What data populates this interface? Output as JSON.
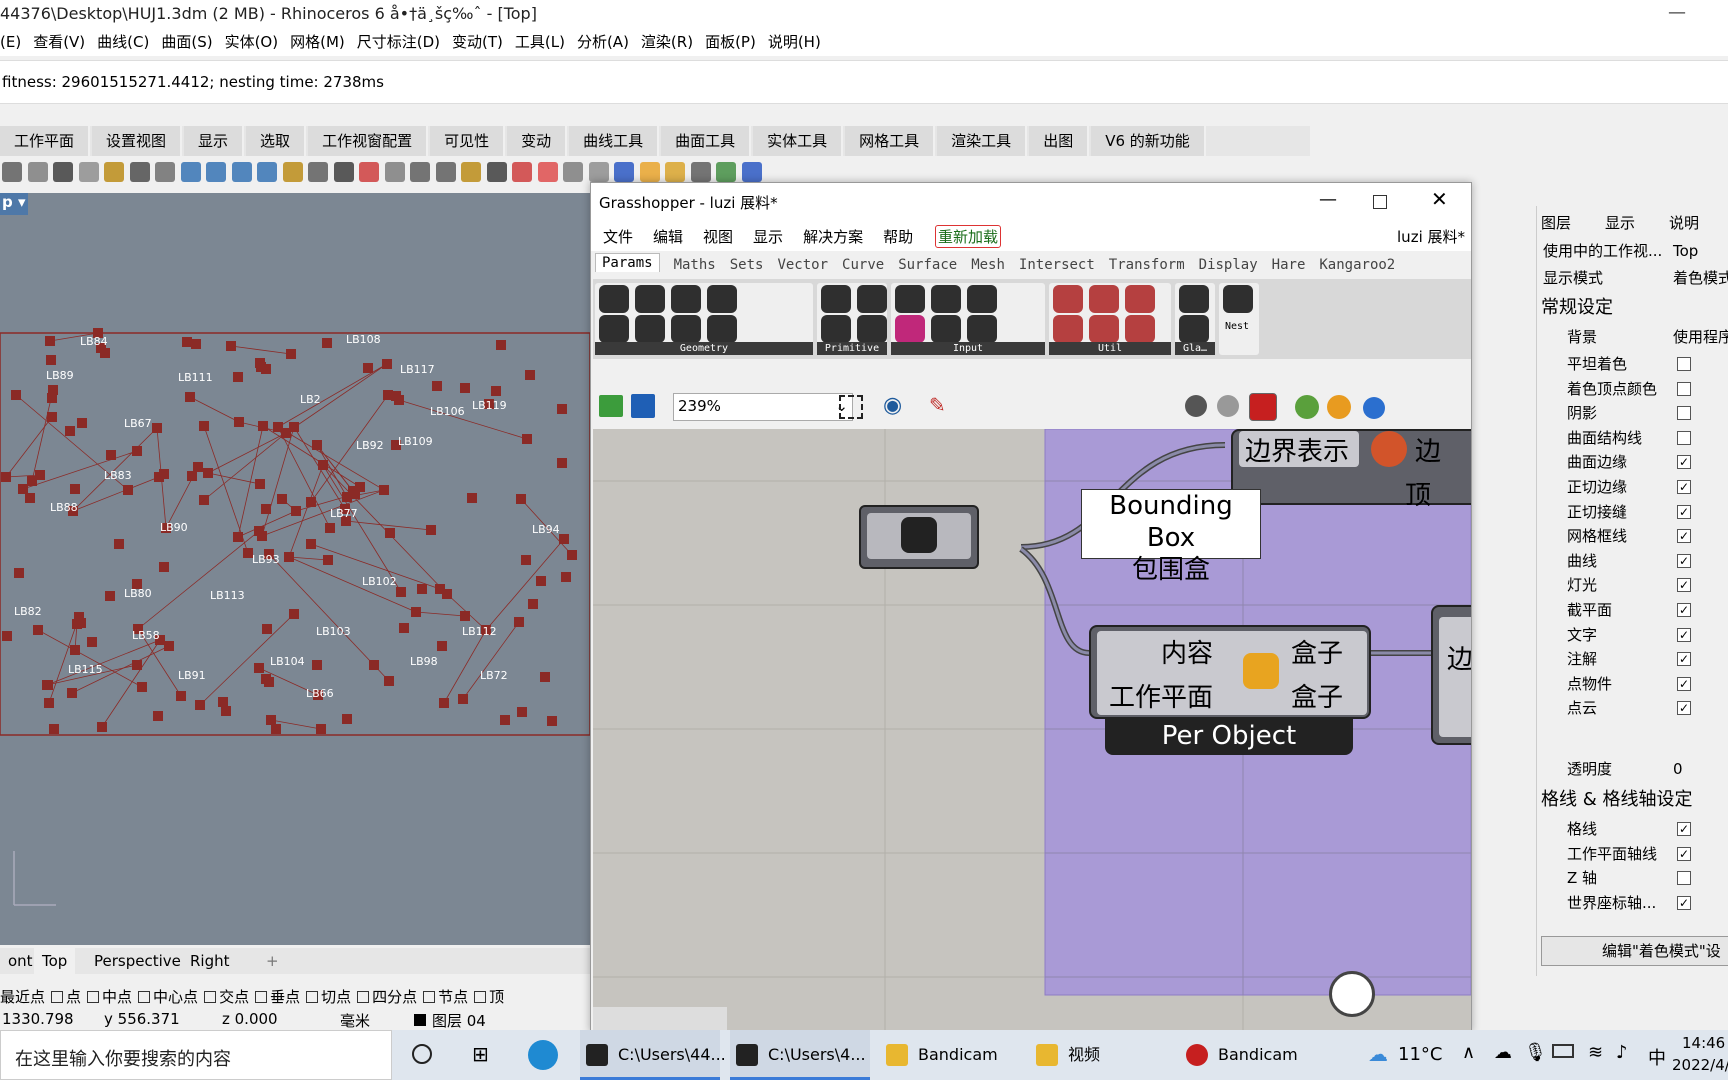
{
  "rhino": {
    "title": "44376\\Desktop\\HUJ1.3dm (2 MB) - Rhinoceros 6 å•†ä¸šç‰ˆ - [Top]",
    "menu": [
      "(E)",
      "查看(V)",
      "曲线(C)",
      "曲面(S)",
      "实体(O)",
      "网格(M)",
      "尺寸标注(D)",
      "变动(T)",
      "工具(L)",
      "分析(A)",
      "渲染(R)",
      "面板(P)",
      "说明(H)"
    ],
    "command_output": "fitness: 29601515271.4412; nesting time: 2738ms",
    "tabs": [
      "工作平面",
      "设置视图",
      "显示",
      "选取",
      "工作视窗配置",
      "可见性",
      "变动",
      "曲线工具",
      "曲面工具",
      "实体工具",
      "网格工具",
      "渲染工具",
      "出图",
      "V6 的新功能"
    ],
    "viewport_label": "p",
    "viewport_tabs": [
      "ont",
      "Top",
      "Perspective",
      "Right"
    ],
    "osnaps": [
      "最近点",
      "点",
      "中点",
      "中心点",
      "交点",
      "垂点",
      "切点",
      "四分点",
      "节点",
      "顶"
    ],
    "status": {
      "x": "1330.798",
      "y": "y 556.371",
      "z": "z 0.000",
      "unit": "毫米",
      "layer": "图层 04"
    },
    "parts": [
      "LB84",
      "LB89",
      "LB111",
      "LB108",
      "LB117",
      "LB67",
      "LB106",
      "LB92",
      "LB109",
      "LB83",
      "LB88",
      "LB90",
      "LB77",
      "LB93",
      "LB80",
      "LB113",
      "LB102",
      "LB82",
      "LB58",
      "LB103",
      "LB112",
      "LB115",
      "LB91",
      "LB104",
      "LB98",
      "LB66",
      "LB72",
      "LB119",
      "LB94",
      "LB2"
    ]
  },
  "grasshopper": {
    "title": "Grasshopper - luzi 展料*",
    "menu": [
      "文件",
      "编辑",
      "视图",
      "显示",
      "解决方案",
      "帮助"
    ],
    "reload": "重新加载",
    "doc_name": "luzi 展料*",
    "tabs": [
      "Params",
      "Maths",
      "Sets",
      "Vector",
      "Curve",
      "Surface",
      "Mesh",
      "Intersect",
      "Transform",
      "Display",
      "Hare",
      "Kangaroo2"
    ],
    "groups": [
      "Geometry",
      "Primitive",
      "Input",
      "Util",
      "Gla…",
      "Nest"
    ],
    "zoom": "239%",
    "canvas": {
      "component_top": {
        "input": "边界表示",
        "output_partial": "边",
        "output_partial2": "顶"
      },
      "tooltip": {
        "en": "Bounding Box",
        "zh": "包围盒"
      },
      "bbox_component": {
        "in1": "内容",
        "in2": "工作平面",
        "out1": "盒子",
        "out2": "盒子",
        "mode": "Per Object"
      },
      "right_partial": "边"
    }
  },
  "right_panel": {
    "tabs": [
      "图层",
      "显示",
      "说明"
    ],
    "viewport_key": "使用中的工作视...",
    "viewport_val": "Top",
    "display_key": "显示模式",
    "display_val": "着色模式",
    "section1": "常规设定",
    "background_key": "背景",
    "background_val": "使用程序",
    "rows": [
      {
        "k": "平坦着色",
        "c": false
      },
      {
        "k": "着色顶点颜色",
        "c": false
      },
      {
        "k": "阴影",
        "c": false
      },
      {
        "k": "曲面结构线",
        "c": false
      },
      {
        "k": "曲面边缘",
        "c": true
      },
      {
        "k": "正切边缘",
        "c": true
      },
      {
        "k": "正切接缝",
        "c": true
      },
      {
        "k": "网格框线",
        "c": true
      },
      {
        "k": "曲线",
        "c": true
      },
      {
        "k": "灯光",
        "c": true
      },
      {
        "k": "截平面",
        "c": true
      },
      {
        "k": "文字",
        "c": true
      },
      {
        "k": "注解",
        "c": true
      },
      {
        "k": "点物件",
        "c": true
      },
      {
        "k": "点云",
        "c": true
      }
    ],
    "transparency_key": "透明度",
    "transparency_val": "0",
    "section2": "格线 & 格线轴设定",
    "rows2": [
      {
        "k": "格线",
        "c": true
      },
      {
        "k": "工作平面轴线",
        "c": true
      },
      {
        "k": "Z 轴",
        "c": false
      },
      {
        "k": "世界座标轴...",
        "c": true
      }
    ],
    "edit_button": "编辑\"着色模式\"设"
  },
  "taskbar": {
    "search": "在这里输入你要搜索的内容",
    "apps": [
      "C:\\Users\\44...",
      "C:\\Users\\4...",
      "Bandicam",
      "视频",
      "Bandicam"
    ],
    "temp": "11°C",
    "ime": "中",
    "time": "14:46",
    "date": "2022/4/"
  },
  "colors": {
    "viewport_bg": "#7c8793",
    "parts": "#8b2a26",
    "gh_canvas": "#c6c4bf",
    "gh_group": "#a99ad6",
    "component": "#5f6068"
  }
}
